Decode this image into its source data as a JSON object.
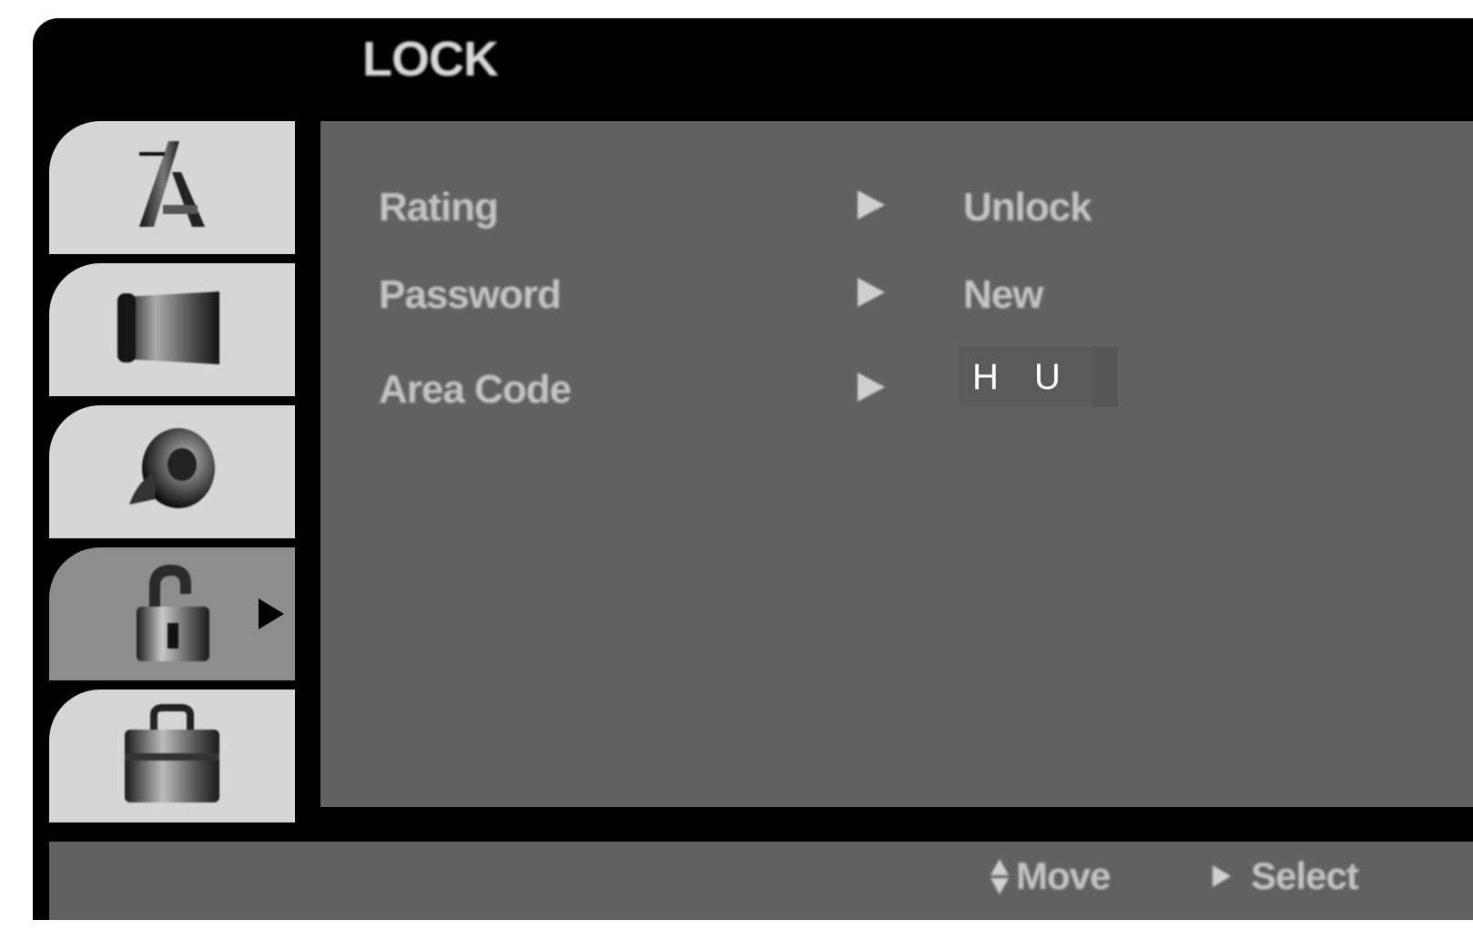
{
  "menu": {
    "title": "LOCK"
  },
  "tabs": [
    {
      "name": "language",
      "icon": "language-a-icon",
      "active": false
    },
    {
      "name": "display",
      "icon": "display-tv-icon",
      "active": false
    },
    {
      "name": "audio",
      "icon": "audio-speaker-icon",
      "active": false
    },
    {
      "name": "lock",
      "icon": "padlock-icon",
      "active": true
    },
    {
      "name": "others",
      "icon": "others-tools-icon",
      "active": false
    }
  ],
  "settings": [
    {
      "label": "Rating",
      "value": "Unlock"
    },
    {
      "label": "Password",
      "value": "New"
    },
    {
      "label": "Area Code",
      "value": "H U"
    }
  ],
  "footer": {
    "move_label": "Move",
    "select_label": "Select"
  },
  "colors": {
    "frame": "#000000",
    "panel": "#616161",
    "tab": "#d6d6d6",
    "tab_active": "#8d8d8d",
    "text": "#c4c4c4"
  }
}
